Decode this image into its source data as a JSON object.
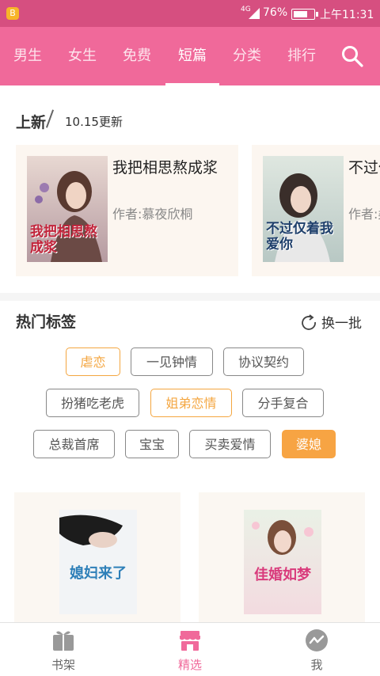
{
  "status_bar": {
    "app_badge": "B",
    "network": "4G",
    "battery_percent": "76%",
    "battery_level": 0.76,
    "time": "上午11:31"
  },
  "top_nav": {
    "tabs": [
      {
        "label": "男生"
      },
      {
        "label": "女生"
      },
      {
        "label": "免费"
      },
      {
        "label": "短篇"
      },
      {
        "label": "分类"
      },
      {
        "label": "排行"
      }
    ],
    "active_tab": "短篇"
  },
  "new_section": {
    "title": "上新",
    "date": "10.15更新",
    "books": [
      {
        "title": "我把相思熬成浆",
        "author": "作者:慕夜欣桐",
        "cover_text": "我把相思熬成浆"
      },
      {
        "title": "不过仅",
        "author": "作者:柔",
        "cover_text": "不过仅着我爱你"
      }
    ]
  },
  "hot_tags": {
    "title": "热门标签",
    "refresh_label": "换一批",
    "tags": [
      {
        "label": "虐恋",
        "style": "orange"
      },
      {
        "label": "一见钟情",
        "style": "plain"
      },
      {
        "label": "协议契约",
        "style": "plain"
      },
      {
        "label": "扮猪吃老虎",
        "style": "plain"
      },
      {
        "label": "姐弟恋情",
        "style": "orange"
      },
      {
        "label": "分手复合",
        "style": "plain"
      },
      {
        "label": "总裁首席",
        "style": "plain"
      },
      {
        "label": "宝宝",
        "style": "plain"
      },
      {
        "label": "买卖爱情",
        "style": "plain"
      },
      {
        "label": "婆媳",
        "style": "filled"
      }
    ]
  },
  "featured_books": [
    {
      "cover_text": "媳妇来了"
    },
    {
      "cover_text": "佳婚如梦"
    }
  ],
  "bottom_nav": {
    "items": [
      {
        "label": "书架"
      },
      {
        "label": "精选"
      },
      {
        "label": "我"
      }
    ],
    "active": "精选"
  },
  "colors": {
    "brand_pink": "#f0699a",
    "status_pink": "#d64f80",
    "tag_orange": "#f7a443"
  }
}
